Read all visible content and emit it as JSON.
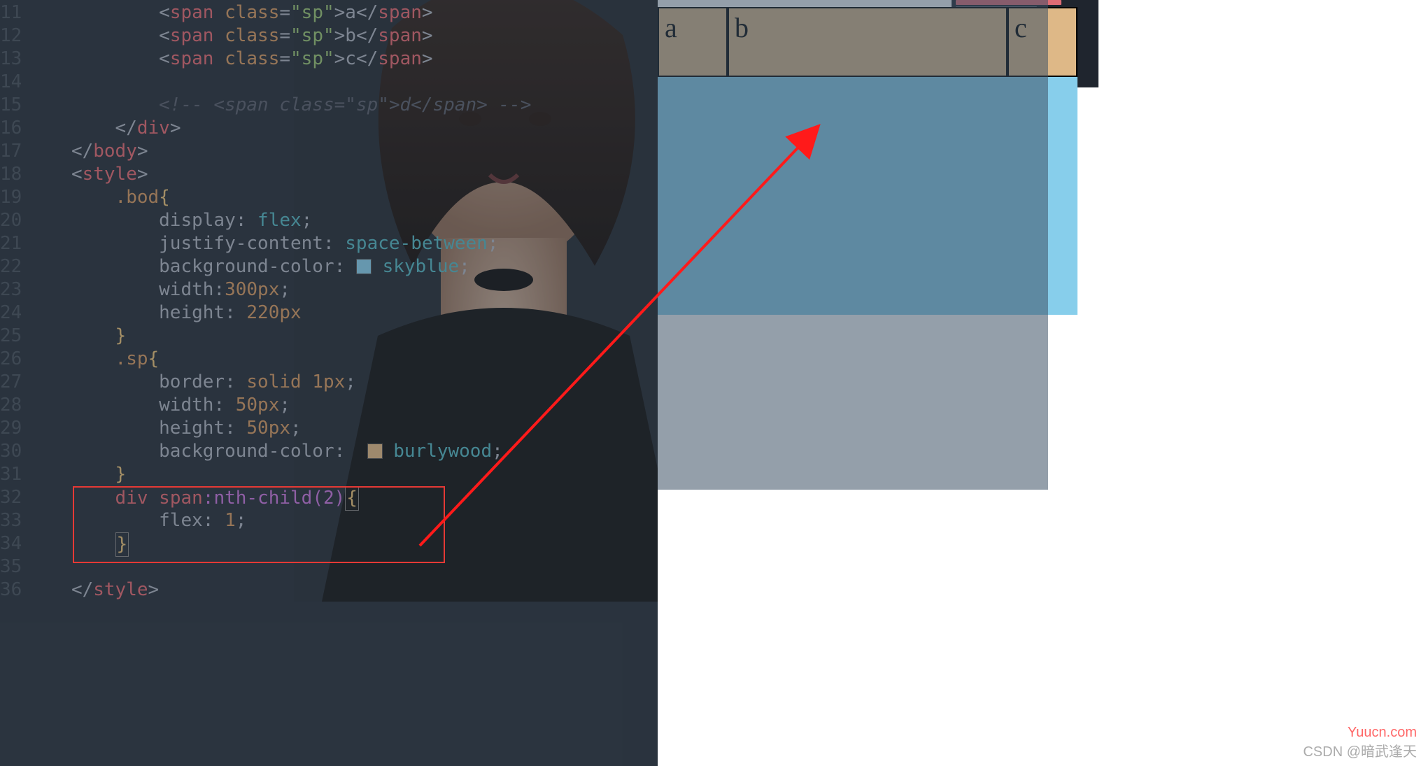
{
  "gutter": {
    "start": 11,
    "end": 36
  },
  "code_lines": {
    "l11": {
      "indent": "            ",
      "open": "<",
      "tag": "span",
      "attr": " class",
      "eq": "=",
      "str": "\"sp\"",
      "gt": ">",
      "text": "a",
      "close": "</",
      "tag2": "span",
      "end": ">"
    },
    "l12": {
      "indent": "            ",
      "open": "<",
      "tag": "span",
      "attr": " class",
      "eq": "=",
      "str": "\"sp\"",
      "gt": ">",
      "text": "b",
      "close": "</",
      "tag2": "span",
      "end": ">"
    },
    "l13": {
      "indent": "            ",
      "open": "<",
      "tag": "span",
      "attr": " class",
      "eq": "=",
      "str": "\"sp\"",
      "gt": ">",
      "text": "c",
      "close": "</",
      "tag2": "span",
      "end": ">"
    },
    "l15_comment": "            <!-- <span class=\"sp\">d</span> -->",
    "l16": {
      "indent": "        ",
      "close": "</",
      "tag": "div",
      "end": ">"
    },
    "l17": {
      "indent": "    ",
      "close": "</",
      "tag": "body",
      "end": ">"
    },
    "l18": {
      "indent": "    ",
      "open": "<",
      "tag": "style",
      "end": ">"
    },
    "l19": {
      "indent": "        ",
      "sel": ".bod",
      "brace": "{"
    },
    "l20": {
      "indent": "            ",
      "prop": "display",
      "colon": ": ",
      "val": "flex",
      "semi": ";"
    },
    "l21": {
      "indent": "            ",
      "prop": "justify-content",
      "colon": ": ",
      "val": "space-between",
      "semi": ";"
    },
    "l22": {
      "indent": "            ",
      "prop": "background-color",
      "colon": ": ",
      "swatch": "#87ceeb",
      "val": "skyblue",
      "semi": ";"
    },
    "l23": {
      "indent": "            ",
      "prop": "width",
      "colon": ":",
      "val": "300px",
      "semi": ";"
    },
    "l24": {
      "indent": "            ",
      "prop": "height",
      "colon": ": ",
      "val": "220px"
    },
    "l25": {
      "indent": "        ",
      "brace": "}"
    },
    "l26": {
      "indent": "        ",
      "sel": ".sp",
      "brace": "{"
    },
    "l27": {
      "indent": "            ",
      "prop": "border",
      "colon": ": ",
      "val": "solid 1px",
      "semi": ";"
    },
    "l28": {
      "indent": "            ",
      "prop": "width",
      "colon": ": ",
      "val": "50px",
      "semi": ";"
    },
    "l29": {
      "indent": "            ",
      "prop": "height",
      "colon": ": ",
      "val": "50px",
      "semi": ";"
    },
    "l30": {
      "indent": "            ",
      "prop": "background-color",
      "colon": ":  ",
      "swatch": "#deb887",
      "val": "burlywood",
      "semi": ";"
    },
    "l31": {
      "indent": "        ",
      "brace": "}"
    },
    "l32": {
      "indent": "        ",
      "sel_tag": "div",
      "sel_tag2": " span",
      "pseudo": ":nth-child(2)",
      "brace": "{"
    },
    "l33": {
      "indent": "            ",
      "prop": "flex",
      "colon": ": ",
      "val": "1",
      "semi": ";"
    },
    "l34": {
      "indent": "        ",
      "brace": "}"
    },
    "l36": {
      "indent": "    ",
      "close": "</",
      "tag": "style",
      "end": ">"
    }
  },
  "preview": {
    "items": [
      "a",
      "b",
      "c"
    ]
  },
  "watermarks": {
    "yuucn": "Yuucn.com",
    "csdn": "CSDN @暗武逢天"
  }
}
